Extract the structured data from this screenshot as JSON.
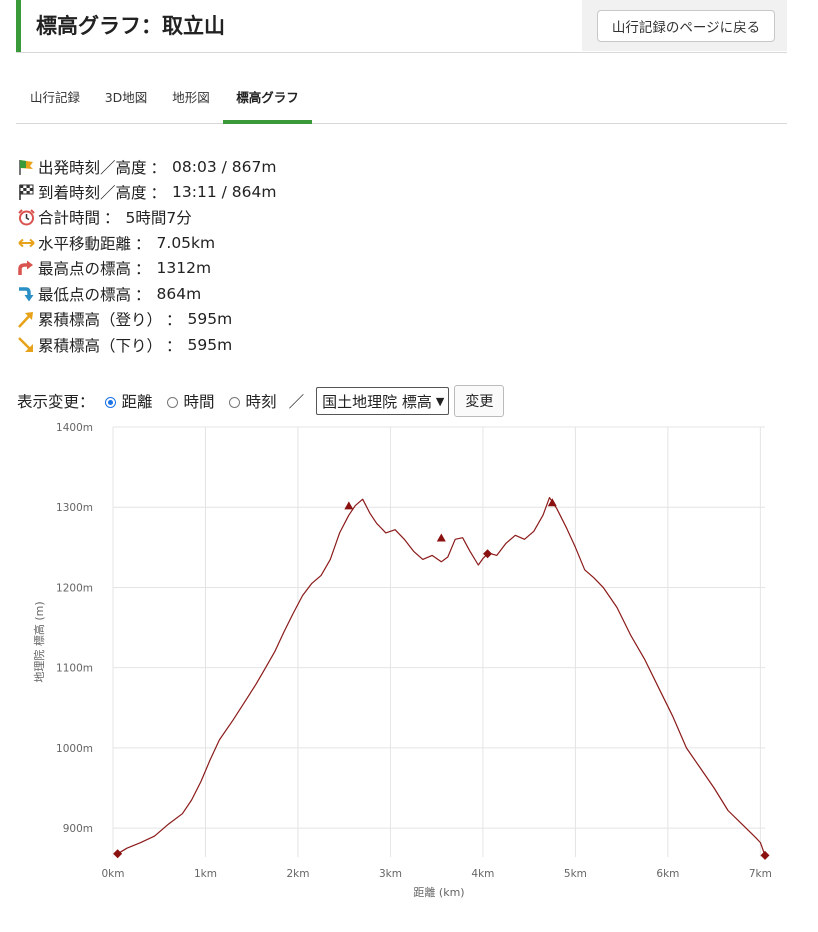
{
  "header": {
    "title": "標高グラフ：取立山",
    "back_label": "山行記録のページに戻る"
  },
  "tabs": [
    "山行記録",
    "3D地図",
    "地形図",
    "標高グラフ"
  ],
  "active_tab": 3,
  "stats": [
    {
      "label": "出発時刻／高度",
      "value": "08:03 / 867m",
      "icon": "start-flag-icon",
      "color": "#e7a21a"
    },
    {
      "label": "到着時刻／高度",
      "value": "13:11 / 864m",
      "icon": "checkered-flag-icon",
      "color": "#333333"
    },
    {
      "label": "合計時間",
      "value": "5時間7分",
      "icon": "alarm-clock-icon",
      "color": "#d9534f"
    },
    {
      "label": "水平移動距離",
      "value": "7.05km",
      "icon": "horizontal-arrow-icon",
      "color": "#e7a21a"
    },
    {
      "label": "最高点の標高",
      "value": "1312m",
      "icon": "up-turn-arrow-icon",
      "color": "#d9534f"
    },
    {
      "label": "最低点の標高",
      "value": "864m",
      "icon": "down-turn-arrow-icon",
      "color": "#2a8fc4"
    },
    {
      "label": "累積標高（登り）",
      "value": "595m",
      "icon": "ascent-arrow-icon",
      "color": "#e7a21a"
    },
    {
      "label": "累積標高（下り）",
      "value": "595m",
      "icon": "descent-arrow-icon",
      "color": "#e7a21a"
    }
  ],
  "controls": {
    "label": "表示変更：",
    "radios": [
      "距離",
      "時間",
      "時刻"
    ],
    "selected_radio": 0,
    "slash": "／",
    "select_value": "国土地理院 標高",
    "change_label": "変更"
  },
  "chart_data": {
    "type": "line",
    "xlabel": "距離 (km)",
    "ylabel": "地理院 標高 (m)",
    "xlim": [
      0,
      7.05
    ],
    "ylim": [
      864,
      1400
    ],
    "x_ticks": [
      0,
      1,
      2,
      3,
      4,
      5,
      6,
      7
    ],
    "x_tick_labels": [
      "0km",
      "1km",
      "2km",
      "3km",
      "4km",
      "5km",
      "6km",
      "7km"
    ],
    "y_ticks": [
      900,
      1000,
      1100,
      1200,
      1300,
      1400
    ],
    "y_tick_labels": [
      "900m",
      "1000m",
      "1100m",
      "1200m",
      "1300m",
      "1400m"
    ],
    "grid": true,
    "line_color": "#8b1a1a",
    "points": [
      [
        0.05,
        868
      ],
      [
        0.15,
        875
      ],
      [
        0.3,
        882
      ],
      [
        0.45,
        890
      ],
      [
        0.6,
        905
      ],
      [
        0.75,
        918
      ],
      [
        0.85,
        935
      ],
      [
        0.95,
        958
      ],
      [
        1.05,
        985
      ],
      [
        1.15,
        1010
      ],
      [
        1.3,
        1035
      ],
      [
        1.45,
        1062
      ],
      [
        1.55,
        1080
      ],
      [
        1.65,
        1100
      ],
      [
        1.75,
        1120
      ],
      [
        1.85,
        1145
      ],
      [
        1.95,
        1168
      ],
      [
        2.05,
        1190
      ],
      [
        2.15,
        1205
      ],
      [
        2.25,
        1215
      ],
      [
        2.35,
        1235
      ],
      [
        2.45,
        1268
      ],
      [
        2.55,
        1290
      ],
      [
        2.62,
        1302
      ],
      [
        2.7,
        1310
      ],
      [
        2.78,
        1292
      ],
      [
        2.85,
        1280
      ],
      [
        2.95,
        1268
      ],
      [
        3.05,
        1272
      ],
      [
        3.15,
        1260
      ],
      [
        3.25,
        1245
      ],
      [
        3.35,
        1235
      ],
      [
        3.45,
        1240
      ],
      [
        3.55,
        1232
      ],
      [
        3.62,
        1238
      ],
      [
        3.7,
        1260
      ],
      [
        3.78,
        1262
      ],
      [
        3.86,
        1245
      ],
      [
        3.95,
        1228
      ],
      [
        4.0,
        1236
      ],
      [
        4.06,
        1243
      ],
      [
        4.15,
        1240
      ],
      [
        4.25,
        1255
      ],
      [
        4.35,
        1265
      ],
      [
        4.45,
        1260
      ],
      [
        4.55,
        1270
      ],
      [
        4.65,
        1290
      ],
      [
        4.72,
        1312
      ],
      [
        4.8,
        1298
      ],
      [
        4.9,
        1275
      ],
      [
        5.0,
        1250
      ],
      [
        5.1,
        1222
      ],
      [
        5.2,
        1212
      ],
      [
        5.3,
        1200
      ],
      [
        5.45,
        1175
      ],
      [
        5.6,
        1140
      ],
      [
        5.75,
        1110
      ],
      [
        5.9,
        1075
      ],
      [
        6.05,
        1040
      ],
      [
        6.2,
        1000
      ],
      [
        6.35,
        975
      ],
      [
        6.5,
        950
      ],
      [
        6.65,
        922
      ],
      [
        6.8,
        905
      ],
      [
        6.95,
        888
      ],
      [
        7.0,
        882
      ],
      [
        7.05,
        866
      ]
    ],
    "markers": [
      {
        "shape": "diamond",
        "x": 0.05,
        "y": 868
      },
      {
        "shape": "triangle",
        "x": 2.55,
        "y": 1301
      },
      {
        "shape": "triangle",
        "x": 3.55,
        "y": 1261
      },
      {
        "shape": "diamond",
        "x": 4.05,
        "y": 1242
      },
      {
        "shape": "triangle",
        "x": 4.75,
        "y": 1305
      },
      {
        "shape": "diamond",
        "x": 7.05,
        "y": 866
      }
    ]
  }
}
